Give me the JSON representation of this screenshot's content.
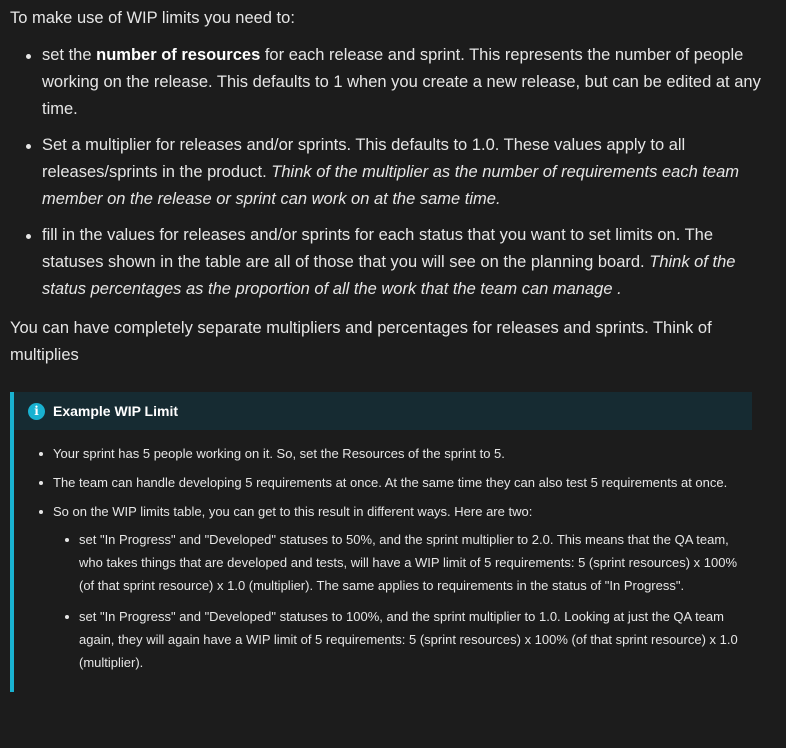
{
  "intro": "To make use of WIP limits you need to:",
  "bullets": [
    {
      "pre": "set the ",
      "bold": "number of resources",
      "post": " for each release and sprint. This represents the number of people working on the release. This defaults to 1 when you create a new release, but can be edited at any time."
    },
    {
      "text": "Set a multiplier for releases and/or sprints. This defaults to 1.0. These values apply to all releases/sprints in the product. ",
      "italic": "Think of the multiplier as the number of requirements each team member on the release or sprint can work on at the same time."
    },
    {
      "text": "fill in the values for releases and/or sprints for each status that you want to set limits on. The statuses shown in the table are all of those that you will see on the planning board. ",
      "italic": "Think of the status percentages as the proportion of all the work that the team can manage ."
    }
  ],
  "separate": "You can have completely separate multipliers and percentages for releases and sprints. Think of multiplies",
  "callout": {
    "icon": "info-icon",
    "accent": "#19b2d1",
    "title": "Example WIP Limit",
    "items": [
      "Your sprint has 5 people working on it. So, set the Resources of the sprint to 5.",
      "The team can handle developing 5 requirements at once. At the same time they can also test 5 requirements at once.",
      "So on the WIP limits table, you can get to this result in different ways. Here are two:"
    ],
    "subitems": [
      "set \"In Progress\" and \"Developed\" statuses to 50%, and the sprint multiplier to 2.0. This means that the QA team, who takes things that are developed and tests, will have a WIP limit of 5 requirements: 5 (sprint resources) x 100% (of that sprint resource) x 1.0 (multiplier). The same applies to requirements in the status of \"In Progress\".",
      "set \"In Progress\" and \"Developed\" statuses to 100%, and the sprint multiplier to 1.0. Looking at just the QA team again, they will again have a WIP limit of 5 requirements: 5 (sprint resources) x 100% (of that sprint resource) x 1.0 (multiplier)."
    ]
  }
}
